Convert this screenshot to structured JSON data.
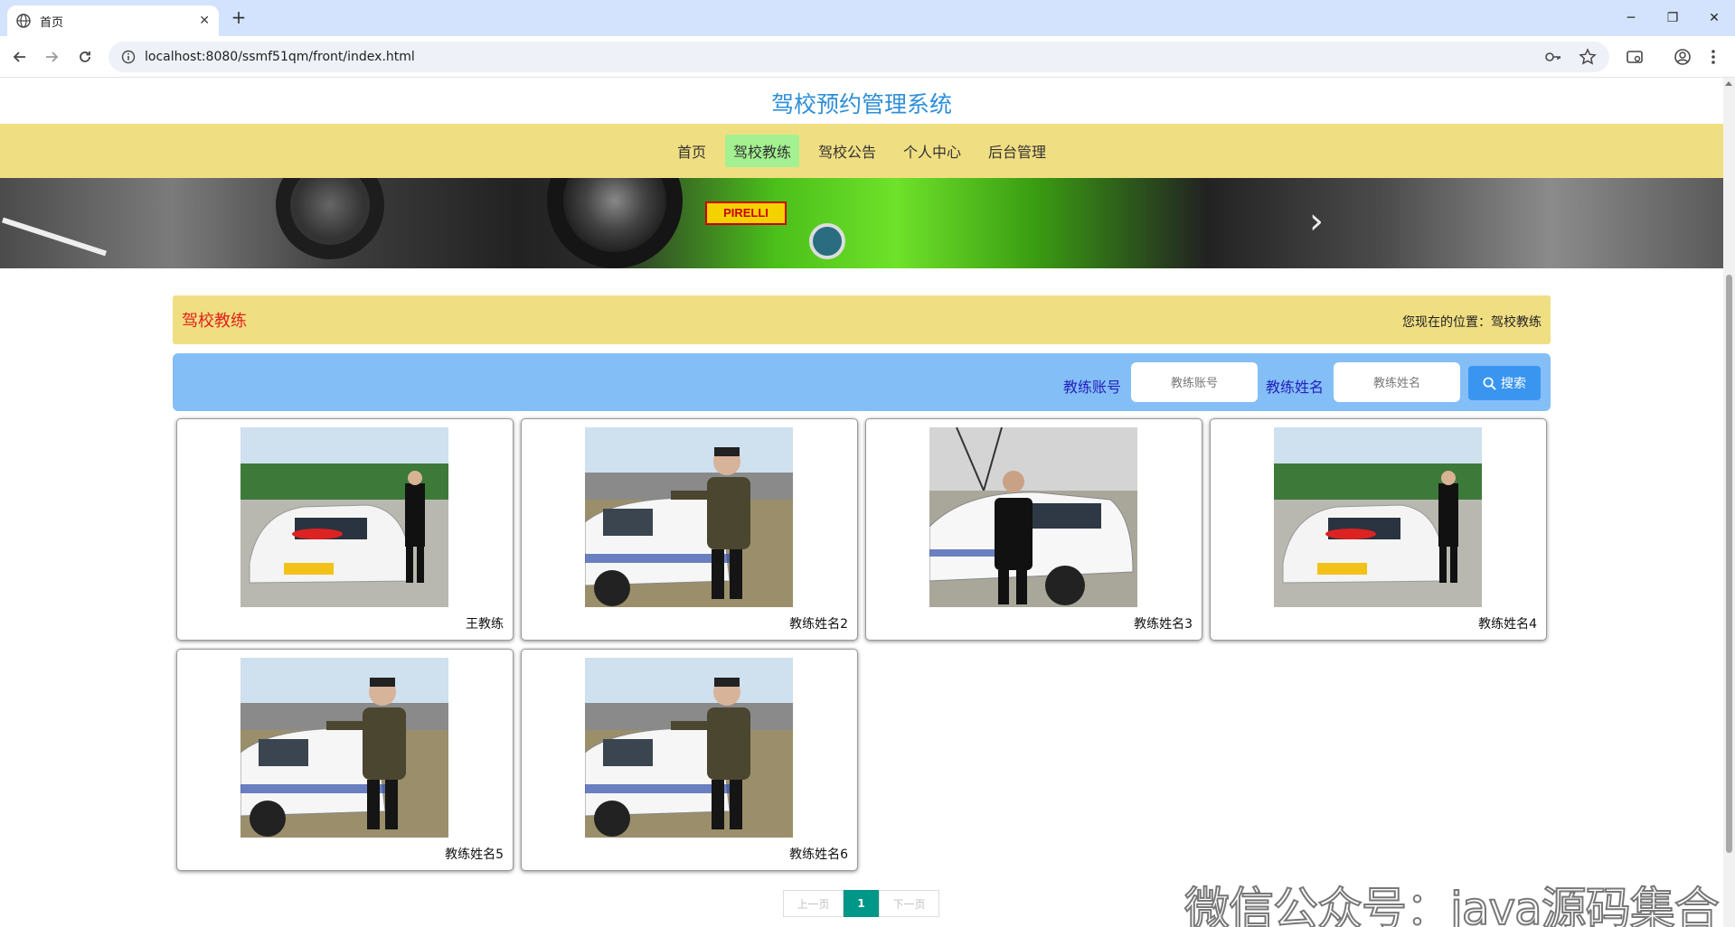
{
  "browser": {
    "tab_title": "首页",
    "new_tab": "+",
    "url": "localhost:8080/ssmf51qm/front/index.html"
  },
  "site": {
    "title": "驾校预约管理系统",
    "menu": [
      {
        "label": "首页",
        "active": false
      },
      {
        "label": "驾校教练",
        "active": true
      },
      {
        "label": "驾校公告",
        "active": false
      },
      {
        "label": "个人中心",
        "active": false
      },
      {
        "label": "后台管理",
        "active": false
      }
    ]
  },
  "banner": {
    "brand_text": "PIRELLI",
    "next_arrow": "›"
  },
  "section": {
    "heading": "驾校教练",
    "location": "您现在的位置：驾校教练"
  },
  "search": {
    "account_label": "教练账号",
    "account_placeholder": "教练账号",
    "name_label": "教练姓名",
    "name_placeholder": "教练姓名",
    "button_label": "搜索"
  },
  "coaches": [
    {
      "name": "王教练",
      "photo": "car-red"
    },
    {
      "name": "教练姓名2",
      "photo": "man-car"
    },
    {
      "name": "教练姓名3",
      "photo": "man-car-wide"
    },
    {
      "name": "教练姓名4",
      "photo": "car-red"
    },
    {
      "name": "教练姓名5",
      "photo": "man-car"
    },
    {
      "name": "教练姓名6",
      "photo": "man-car"
    }
  ],
  "pagination": {
    "prev": "上一页",
    "current": "1",
    "next": "下一页"
  },
  "watermark": "微信公众号：java源码集合"
}
